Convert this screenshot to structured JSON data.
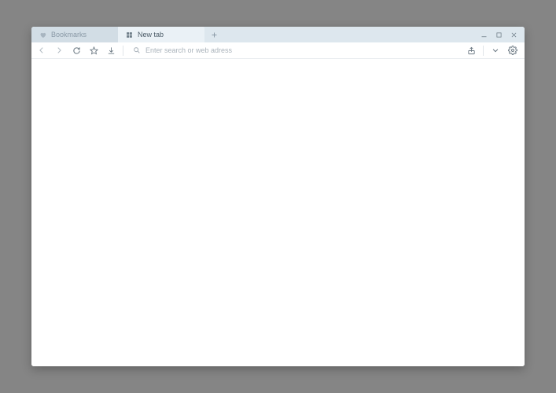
{
  "tabs": [
    {
      "label": "Bookmarks",
      "icon": "heart-icon",
      "active": false
    },
    {
      "label": "New tab",
      "icon": "grid-icon",
      "active": true
    }
  ],
  "addressbar": {
    "placeholder": "Enter search or web adress",
    "value": ""
  }
}
